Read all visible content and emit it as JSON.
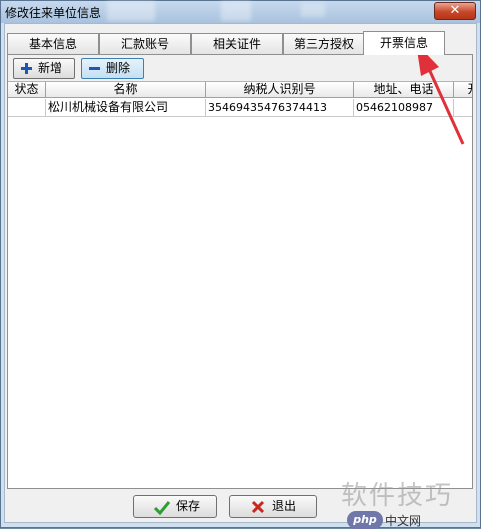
{
  "window": {
    "title": "修改往来单位信息",
    "close_label": "✕"
  },
  "tabs": [
    {
      "label": "基本信息",
      "active": false
    },
    {
      "label": "汇款账号",
      "active": false
    },
    {
      "label": "相关证件",
      "active": false
    },
    {
      "label": "第三方授权",
      "active": false
    },
    {
      "label": "开票信息",
      "active": true
    }
  ],
  "toolbar": {
    "add_label": "新增",
    "delete_label": "删除"
  },
  "table": {
    "columns": [
      "状态",
      "名称",
      "纳税人识别号",
      "地址、电话",
      "开"
    ],
    "rows": [
      {
        "status": "",
        "name": "松川机械设备有限公司",
        "tax_id": "35469435476374413",
        "address_phone": "05462108987",
        "extra": ""
      }
    ]
  },
  "footer": {
    "save_label": "保存",
    "exit_label": "退出"
  },
  "watermark": {
    "text": "软件技巧",
    "badge": "php",
    "site": "中文网"
  },
  "colors": {
    "annotation_arrow": "#e0303a",
    "save_check": "#2e9e2e",
    "exit_cross": "#c8281e"
  }
}
